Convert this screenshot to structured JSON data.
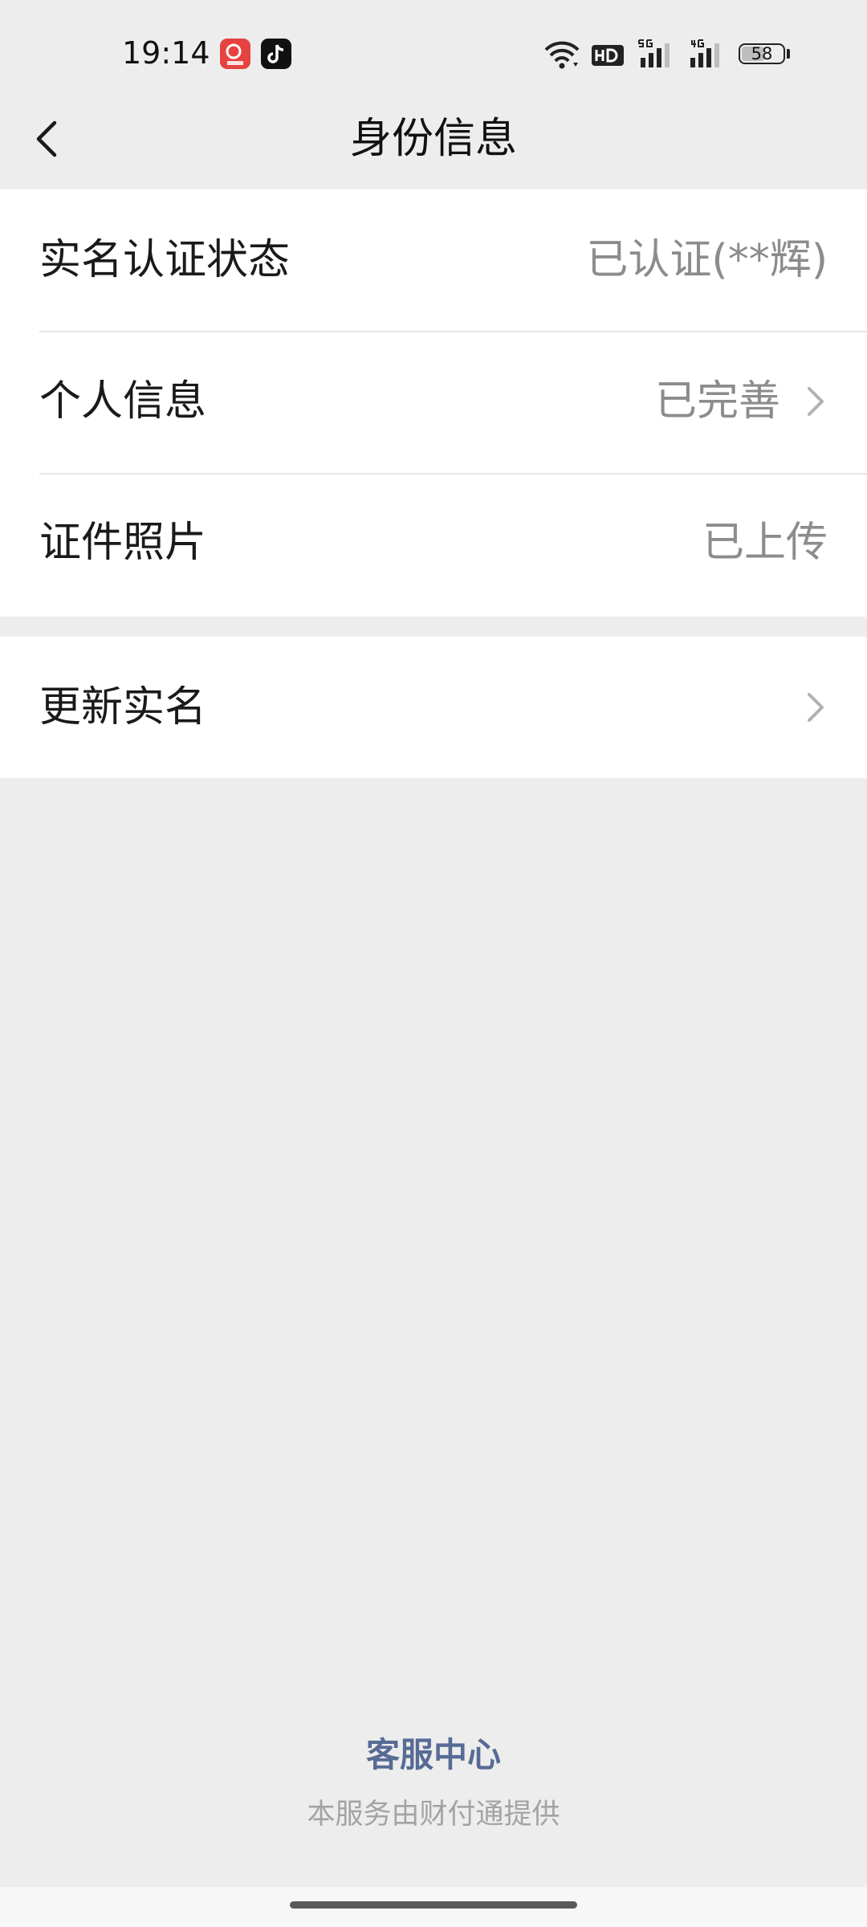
{
  "status_bar": {
    "time": "19:14",
    "battery": "58",
    "battery_level": 0.58,
    "icons": [
      "app-red-icon",
      "tiktok-icon",
      "wifi-icon",
      "hd-icon",
      "5g-signal-icon",
      "4g-signal-icon",
      "battery-icon"
    ]
  },
  "header": {
    "title": "身份信息",
    "back_icon": "chevron-left-icon"
  },
  "rows": [
    {
      "label": "实名认证状态",
      "value": "已认证(**辉)"
    },
    {
      "label": "个人信息",
      "value": "已完善"
    },
    {
      "label": "证件照片",
      "value": "已上传"
    },
    {
      "label": "更新实名",
      "value": ""
    }
  ],
  "footer": {
    "link": "客服中心",
    "note": "本服务由财付通提供"
  },
  "colors": {
    "background": "#ededed",
    "card": "#ffffff",
    "link": "#576b95",
    "secondary_text": "#8c8c8c"
  }
}
